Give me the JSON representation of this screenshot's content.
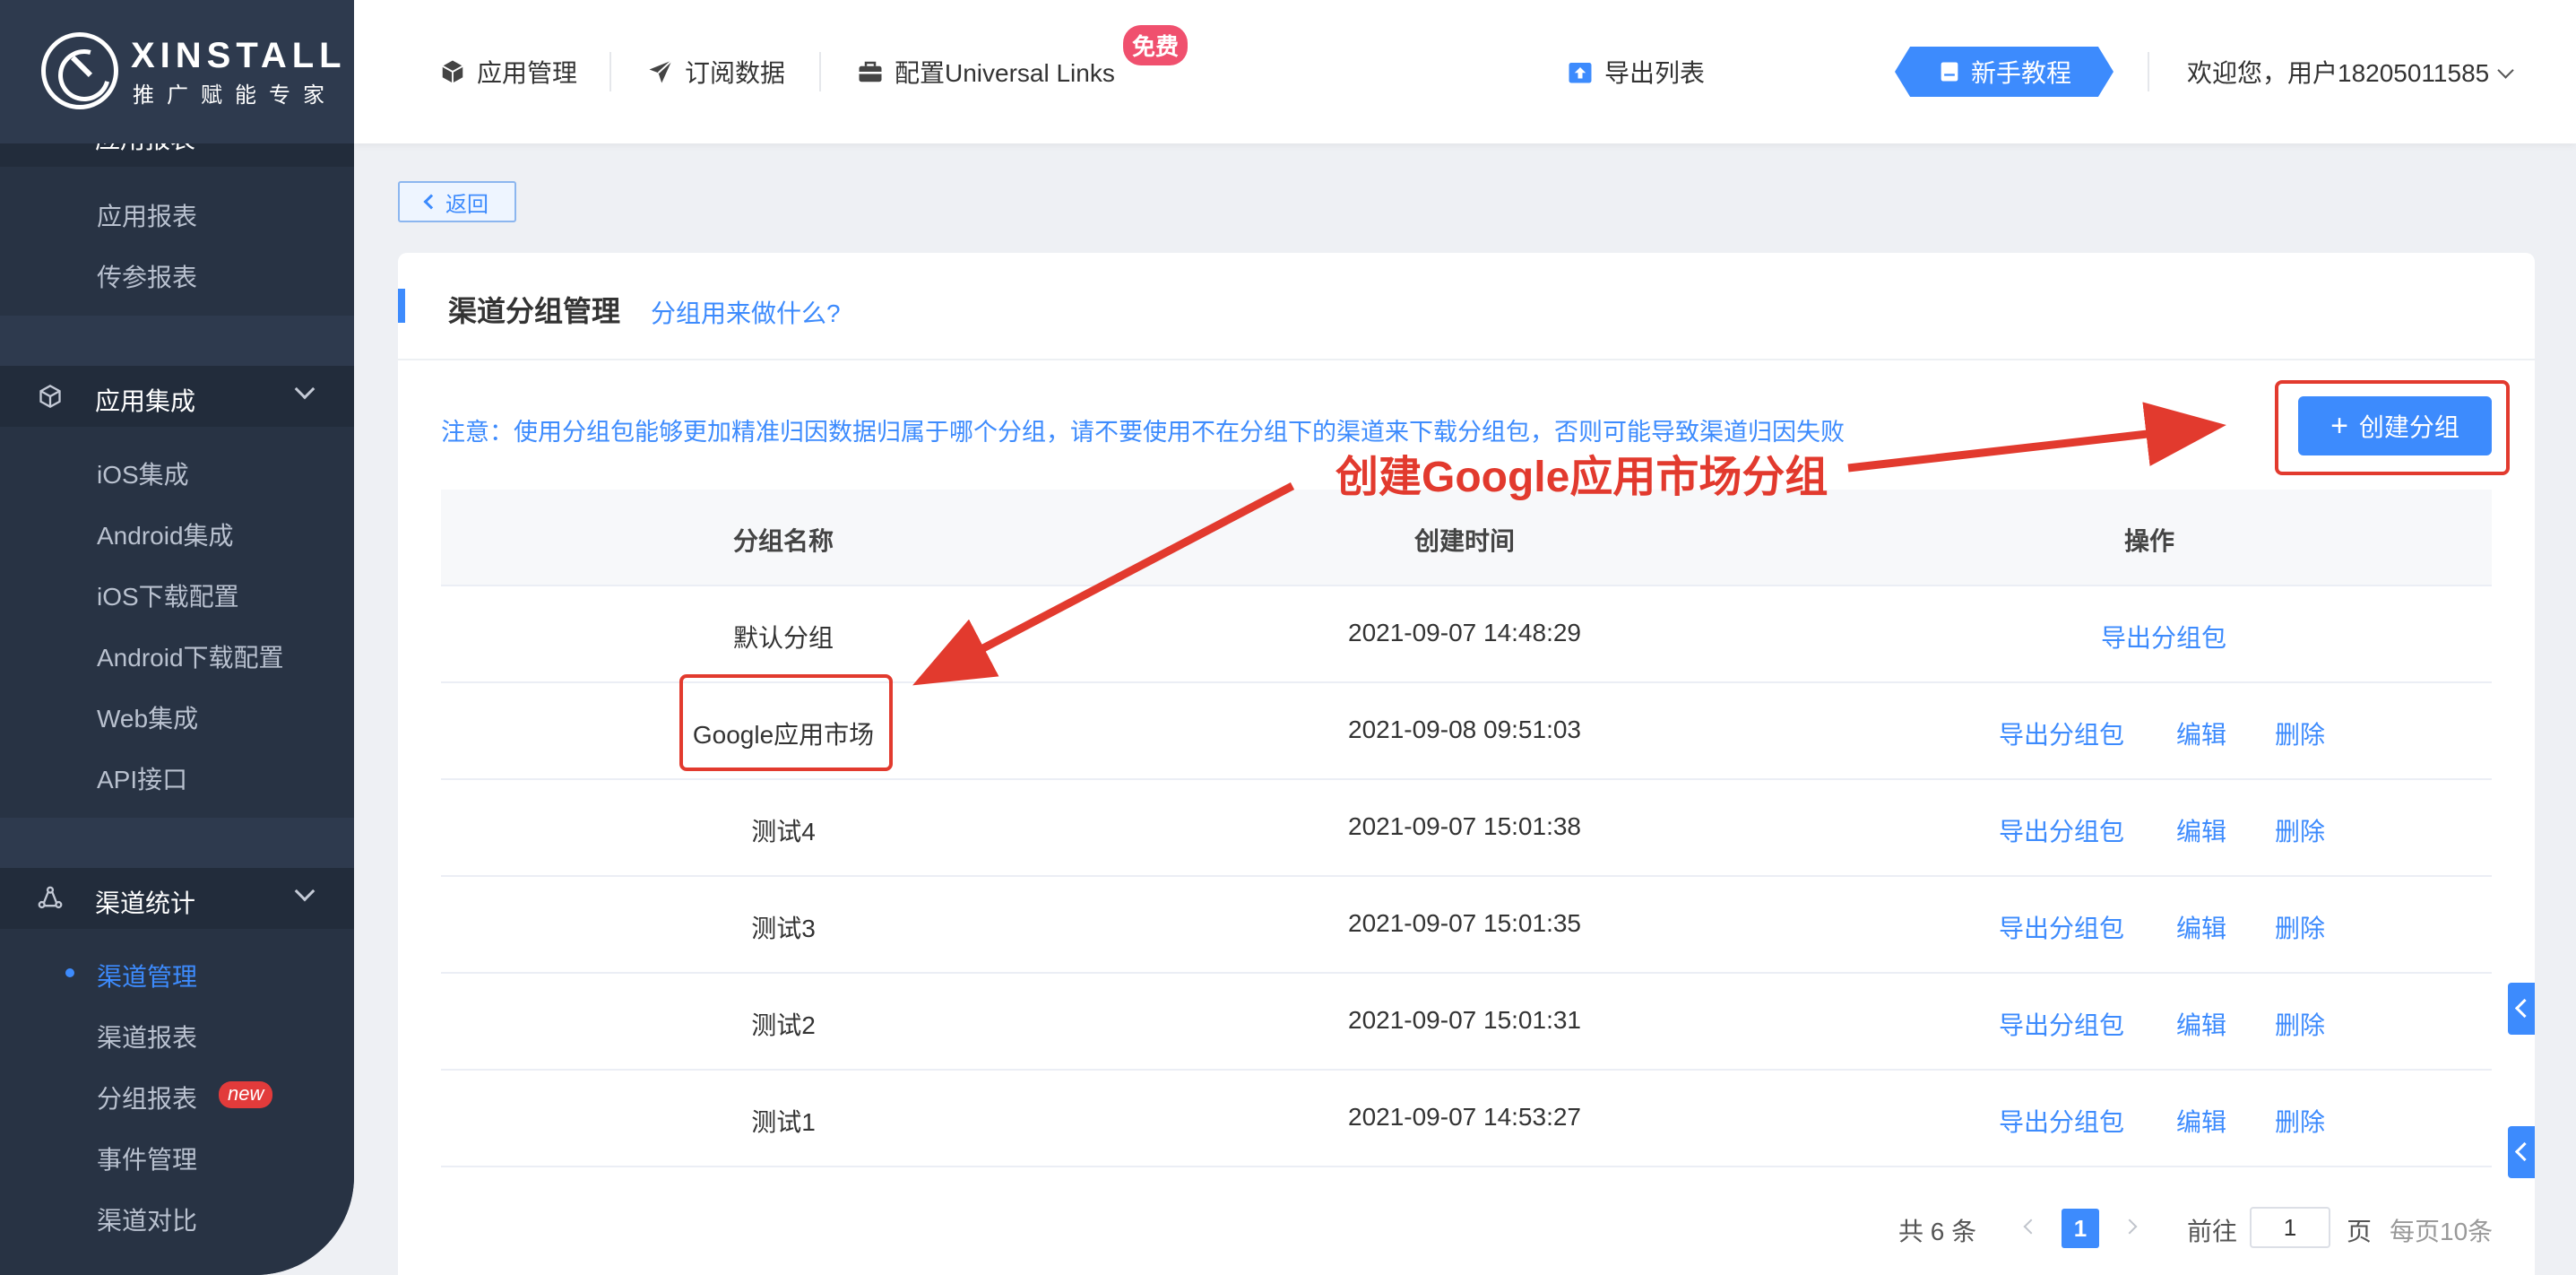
{
  "brand": {
    "title": "XINSTALL",
    "subtitle": "推广赋能专家"
  },
  "sidebar": {
    "partial_item": "应用报表",
    "group1_items": [
      "应用报表",
      "传参报表"
    ],
    "sections": [
      {
        "label": "应用集成",
        "items": [
          "iOS集成",
          "Android集成",
          "iOS下载配置",
          "Android下载配置",
          "Web集成",
          "API接口"
        ]
      },
      {
        "label": "渠道统计",
        "items": [
          "渠道管理",
          "渠道报表",
          "分组报表",
          "事件管理",
          "渠道对比"
        ]
      }
    ],
    "active_item": "渠道管理",
    "new_badge": "new"
  },
  "header": {
    "nav": [
      "应用管理",
      "订阅数据",
      "配置Universal Links",
      "导出列表"
    ],
    "free_badge": "免费",
    "tutorial": "新手教程",
    "welcome": "欢迎您，用户18205011585"
  },
  "back_label": "返回",
  "card": {
    "title": "渠道分组管理",
    "help_link": "分组用来做什么?",
    "notice": "注意：使用分组包能够更加精准归因数据归属于哪个分组，请不要使用不在分组下的渠道来下载分组包，否则可能导致渠道归因失败",
    "create_button": "创建分组"
  },
  "table": {
    "headers": [
      "分组名称",
      "创建时间",
      "操作"
    ],
    "actions": {
      "export": "导出分组包",
      "edit": "编辑",
      "delete": "删除"
    },
    "rows": [
      {
        "name": "默认分组",
        "created": "2021-09-07 14:48:29"
      },
      {
        "name": "Google应用市场",
        "created": "2021-09-08 09:51:03"
      },
      {
        "name": "测试4",
        "created": "2021-09-07 15:01:38"
      },
      {
        "name": "测试3",
        "created": "2021-09-07 15:01:35"
      },
      {
        "name": "测试2",
        "created": "2021-09-07 15:01:31"
      },
      {
        "name": "测试1",
        "created": "2021-09-07 14:53:27"
      }
    ]
  },
  "pagination": {
    "total": "共 6 条",
    "current_page": "1",
    "goto_label": "前往",
    "goto_value": "1",
    "page_label": "页",
    "page_size": "每页10条"
  },
  "annotation": {
    "text": "创建Google应用市场分组",
    "color": "#e23a2e"
  },
  "colors": {
    "accent": "#3d8bfd",
    "sidebar_bg": "#2e3a4e",
    "annotation": "#e23a2e"
  }
}
